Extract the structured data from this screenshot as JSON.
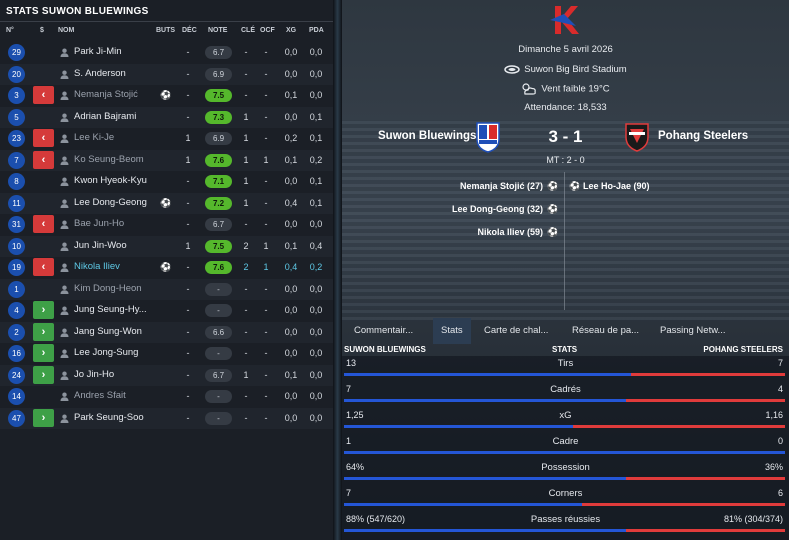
{
  "left_panel": {
    "title": "STATS SUWON BLUEWINGS",
    "headers": {
      "num": "N°",
      "sub": "$",
      "name": "NOM",
      "goals": "BUTS",
      "dec": "DÉC",
      "note": "NOTE",
      "key": "CLÉ",
      "ocf": "OCF",
      "xg": "XG",
      "xa": "PDA"
    },
    "players": [
      {
        "num": "29",
        "sub": "",
        "name": "Park Ji-Min",
        "style": "normal",
        "goal": false,
        "buts": "",
        "dec": "-",
        "note": "6.7",
        "note_good": false,
        "cle": "-",
        "ocf": "-",
        "xg": "0,0",
        "pda": "0,0"
      },
      {
        "num": "20",
        "sub": "",
        "name": "S. Anderson",
        "style": "normal",
        "goal": false,
        "buts": "",
        "dec": "-",
        "note": "6.9",
        "note_good": false,
        "cle": "-",
        "ocf": "-",
        "xg": "0,0",
        "pda": "0,0"
      },
      {
        "num": "3",
        "sub": "out",
        "name": "Nemanja Stojić",
        "style": "dim",
        "goal": true,
        "buts": "",
        "dec": "-",
        "note": "7.5",
        "note_good": true,
        "cle": "-",
        "ocf": "-",
        "xg": "0,1",
        "pda": "0,0"
      },
      {
        "num": "5",
        "sub": "",
        "name": "Adrian Bajrami",
        "style": "normal",
        "goal": false,
        "buts": "",
        "dec": "-",
        "note": "7.3",
        "note_good": true,
        "cle": "1",
        "ocf": "-",
        "xg": "0,0",
        "pda": "0,1"
      },
      {
        "num": "23",
        "sub": "out",
        "name": "Lee Ki-Je",
        "style": "dim",
        "goal": false,
        "buts": "",
        "dec": "1",
        "note": "6.9",
        "note_good": false,
        "cle": "1",
        "ocf": "-",
        "xg": "0,2",
        "pda": "0,1"
      },
      {
        "num": "7",
        "sub": "out",
        "name": "Ko Seung-Beom",
        "style": "dim",
        "goal": false,
        "buts": "",
        "dec": "1",
        "note": "7.6",
        "note_good": true,
        "cle": "1",
        "ocf": "1",
        "xg": "0,1",
        "pda": "0,2"
      },
      {
        "num": "8",
        "sub": "",
        "name": "Kwon Hyeok-Kyu",
        "style": "normal",
        "goal": false,
        "buts": "",
        "dec": "-",
        "note": "7.1",
        "note_good": true,
        "cle": "1",
        "ocf": "-",
        "xg": "0,0",
        "pda": "0,1"
      },
      {
        "num": "11",
        "sub": "",
        "name": "Lee Dong-Geong",
        "style": "normal",
        "goal": true,
        "buts": "",
        "dec": "-",
        "note": "7.2",
        "note_good": true,
        "cle": "1",
        "ocf": "-",
        "xg": "0,4",
        "pda": "0,1"
      },
      {
        "num": "31",
        "sub": "out",
        "name": "Bae Jun-Ho",
        "style": "dim",
        "goal": false,
        "buts": "",
        "dec": "-",
        "note": "6.7",
        "note_good": false,
        "cle": "-",
        "ocf": "-",
        "xg": "0,0",
        "pda": "0,0"
      },
      {
        "num": "10",
        "sub": "",
        "name": "Jun Jin-Woo",
        "style": "normal",
        "goal": false,
        "buts": "",
        "dec": "1",
        "note": "7.5",
        "note_good": true,
        "cle": "2",
        "ocf": "1",
        "xg": "0,1",
        "pda": "0,4"
      },
      {
        "num": "19",
        "sub": "out",
        "name": "Nikola Iliev",
        "style": "hl",
        "goal": true,
        "buts": "",
        "dec": "-",
        "note": "7.6",
        "note_good": true,
        "cle": "2",
        "ocf": "1",
        "xg": "0,4",
        "pda": "0,2"
      },
      {
        "num": "1",
        "sub": "",
        "name": "Kim Dong-Heon",
        "style": "dim",
        "goal": false,
        "buts": "",
        "dec": "-",
        "note": "-",
        "note_good": false,
        "cle": "-",
        "ocf": "-",
        "xg": "0,0",
        "pda": "0,0"
      },
      {
        "num": "4",
        "sub": "in",
        "name": "Jung Seung-Hy...",
        "style": "normal",
        "goal": false,
        "buts": "",
        "dec": "-",
        "note": "-",
        "note_good": false,
        "cle": "-",
        "ocf": "-",
        "xg": "0,0",
        "pda": "0,0"
      },
      {
        "num": "2",
        "sub": "in",
        "name": "Jang Sung-Won",
        "style": "normal",
        "goal": false,
        "buts": "",
        "dec": "-",
        "note": "6.6",
        "note_good": false,
        "cle": "-",
        "ocf": "-",
        "xg": "0,0",
        "pda": "0,0"
      },
      {
        "num": "16",
        "sub": "in",
        "name": "Lee Jong-Sung",
        "style": "normal",
        "goal": false,
        "buts": "",
        "dec": "-",
        "note": "-",
        "note_good": false,
        "cle": "-",
        "ocf": "-",
        "xg": "0,0",
        "pda": "0,0"
      },
      {
        "num": "24",
        "sub": "in",
        "name": "Jo Jin-Ho",
        "style": "normal",
        "goal": false,
        "buts": "",
        "dec": "-",
        "note": "6.7",
        "note_good": false,
        "cle": "1",
        "ocf": "-",
        "xg": "0,1",
        "pda": "0,0"
      },
      {
        "num": "14",
        "sub": "",
        "name": "Andres Sfait",
        "style": "dim",
        "goal": false,
        "buts": "",
        "dec": "-",
        "note": "-",
        "note_good": false,
        "cle": "-",
        "ocf": "-",
        "xg": "0,0",
        "pda": "0,0"
      },
      {
        "num": "47",
        "sub": "in",
        "name": "Park Seung-Soo",
        "style": "normal",
        "goal": false,
        "buts": "",
        "dec": "-",
        "note": "-",
        "note_good": false,
        "cle": "-",
        "ocf": "-",
        "xg": "0,0",
        "pda": "0,0"
      }
    ]
  },
  "match": {
    "date": "Dimanche 5 avril 2026",
    "stadium": "Suwon Big Bird Stadium",
    "weather": "Vent faible 19°C",
    "attendance": "Attendance: 18,533",
    "home_team": "Suwon Bluewings",
    "away_team": "Pohang Steelers",
    "score": "3 - 1",
    "halftime": "MT : 2 - 0",
    "home_scorers": [
      "Nemanja Stojić (27)",
      "Lee Dong-Geong (32)",
      "Nikola Iliev (59)"
    ],
    "away_scorers": [
      "Lee Ho-Jae (90)"
    ],
    "home_color": "#2456d6",
    "away_color": "#e03b3b"
  },
  "tabs": [
    "Commentair...",
    "Stats",
    "Carte de chal...",
    "Réseau de pa...",
    "Passing Netw..."
  ],
  "active_tab": "Stats",
  "stats": {
    "home_header": "SUWON BLUEWINGS",
    "center_header": "STATS",
    "away_header": "POHANG STEELERS",
    "rows": [
      {
        "label": "Tirs",
        "home": "13",
        "away": "7",
        "home_share": 0.65
      },
      {
        "label": "Cadrés",
        "home": "7",
        "away": "4",
        "home_share": 0.64
      },
      {
        "label": "xG",
        "home": "1,25",
        "away": "1,16",
        "home_share": 0.52
      },
      {
        "label": "Cadre",
        "home": "1",
        "away": "0",
        "home_share": 1.0
      },
      {
        "label": "Possession",
        "home": "64%",
        "away": "36%",
        "home_share": 0.64
      },
      {
        "label": "Corners",
        "home": "7",
        "away": "6",
        "home_share": 0.54
      },
      {
        "label": "Passes réussies",
        "home": "88% (547/620)",
        "away": "81% (304/374)",
        "home_share": 0.64
      }
    ]
  }
}
